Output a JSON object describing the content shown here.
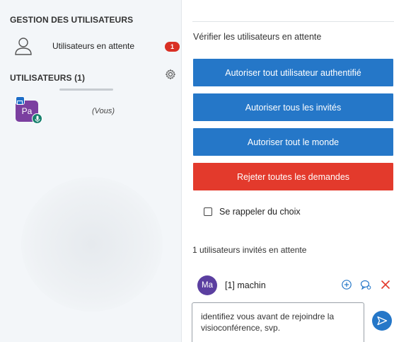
{
  "sidebar": {
    "management_title": "GESTION DES UTILISATEURS",
    "waiting_users_label": "Utilisateurs en attente",
    "waiting_count": "1",
    "users_title": "UTILISATEURS (1)",
    "current_user": {
      "initials": "Pa",
      "you_label": "(Vous)"
    }
  },
  "waiting_panel": {
    "verify_label": "Vérifier les utilisateurs en attente",
    "buttons": [
      {
        "label": "Autoriser tout utilisateur authentifié"
      },
      {
        "label": "Autoriser tous les invités"
      },
      {
        "label": "Autoriser tout le monde"
      },
      {
        "label": "Rejeter toutes les demandes"
      }
    ],
    "remember_label": "Se rappeler du choix",
    "guests_count_label": "1 utilisateurs invités en attente",
    "guest": {
      "initials": "Ma",
      "name": "[1] machin"
    },
    "message": {
      "value": "identifiez vous avant de rejoindre la visioconférence, svp."
    }
  },
  "colors": {
    "primary": "#2577c8",
    "danger": "#e33a2c",
    "badge": "#d93025",
    "user_avatar": "#7b3fa0",
    "guest_avatar": "#5b3fa0"
  },
  "icons": [
    "user-outline-icon",
    "gear-icon",
    "presenter-icon",
    "microphone-icon",
    "plus-circle-icon",
    "chat-icon",
    "close-icon",
    "send-icon"
  ]
}
